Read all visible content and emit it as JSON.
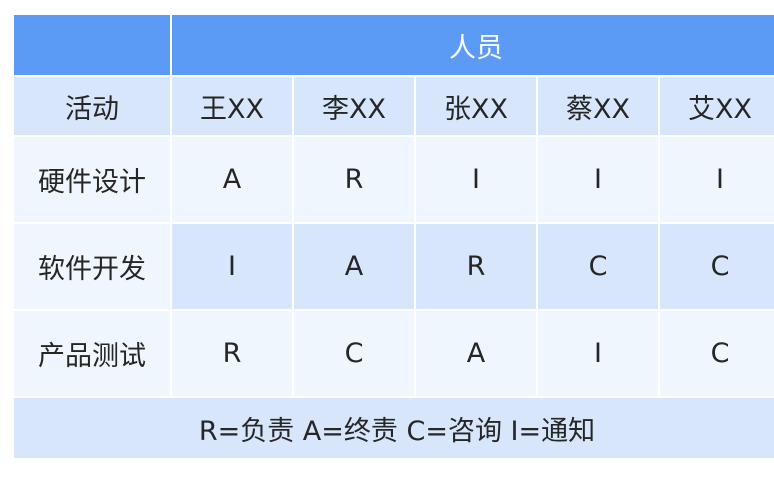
{
  "table": {
    "header_group": "人员",
    "activity_header": "活动",
    "people": [
      "王XX",
      "李XX",
      "张XX",
      "蔡XX",
      "艾XX"
    ],
    "rows": [
      {
        "activity": "硬件设计",
        "values": [
          "A",
          "R",
          "I",
          "I",
          "I"
        ]
      },
      {
        "activity": "软件开发",
        "values": [
          "I",
          "A",
          "R",
          "C",
          "C"
        ]
      },
      {
        "activity": "产品测试",
        "values": [
          "R",
          "C",
          "A",
          "I",
          "C"
        ]
      }
    ],
    "legend": "R=负责 A=终责 C=咨询 I=通知"
  },
  "colors": {
    "header_blue": "#5b9bf5",
    "light_blue": "#d7e6fb",
    "pale_blue": "#f0f6fd",
    "text": "#262626"
  }
}
